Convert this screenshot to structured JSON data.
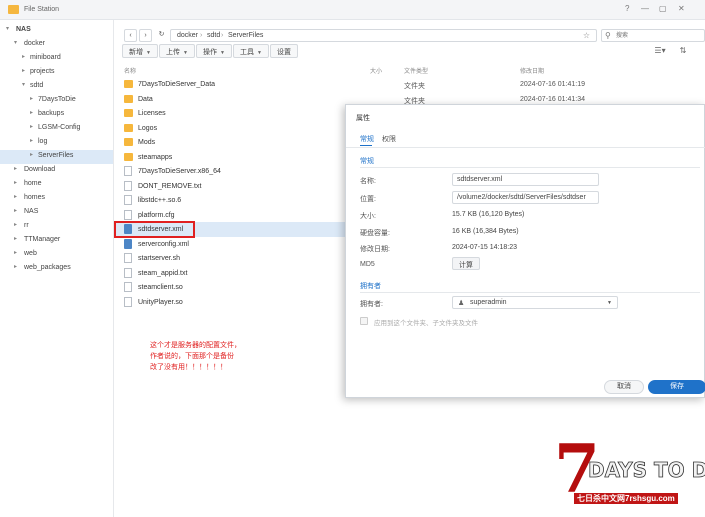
{
  "window": {
    "title": "File Station",
    "controls": [
      "?",
      "—",
      "▢",
      "✕"
    ]
  },
  "sidebar": {
    "items": [
      {
        "label": "NAS",
        "level": 0,
        "expanded": true
      },
      {
        "label": "docker",
        "level": 1,
        "expanded": true
      },
      {
        "label": "miniboard",
        "level": 2,
        "expanded": false
      },
      {
        "label": "projects",
        "level": 2,
        "expanded": false
      },
      {
        "label": "sdtd",
        "level": 2,
        "expanded": true
      },
      {
        "label": "7DaysToDie",
        "level": 3,
        "expanded": false
      },
      {
        "label": "backups",
        "level": 3,
        "expanded": false
      },
      {
        "label": "LGSM-Config",
        "level": 3,
        "expanded": false
      },
      {
        "label": "log",
        "level": 3,
        "expanded": false
      },
      {
        "label": "ServerFiles",
        "level": 3,
        "expanded": false,
        "selected": true
      },
      {
        "label": "Download",
        "level": 1,
        "expanded": false
      },
      {
        "label": "home",
        "level": 1,
        "expanded": false
      },
      {
        "label": "homes",
        "level": 1,
        "expanded": false
      },
      {
        "label": "NAS",
        "level": 1,
        "expanded": false
      },
      {
        "label": "rr",
        "level": 1,
        "expanded": false
      },
      {
        "label": "TTManager",
        "level": 1,
        "expanded": false
      },
      {
        "label": "web",
        "level": 1,
        "expanded": false
      },
      {
        "label": "web_packages",
        "level": 1,
        "expanded": false
      }
    ]
  },
  "pathbar": {
    "crumbs": [
      "docker",
      "sdtd",
      "ServerFiles"
    ],
    "separator": "›"
  },
  "search": {
    "placeholder": "搜索"
  },
  "toolbar": {
    "new_label": "新增",
    "upload_label": "上传",
    "action_label": "操作",
    "tools_label": "工具",
    "settings_label": "设置"
  },
  "list": {
    "headers": {
      "name": "名称",
      "size": "大小",
      "type": "文件类型",
      "date": "修改日期"
    },
    "rows": [
      {
        "name": "7DaysToDieServer_Data",
        "kind": "folder",
        "type": "文件夹",
        "date": "2024-07-16 01:41:19"
      },
      {
        "name": "Data",
        "kind": "folder",
        "type": "文件夹",
        "date": "2024-07-16 01:41:34"
      },
      {
        "name": "Licenses",
        "kind": "folder",
        "type": "",
        "date": ""
      },
      {
        "name": "Logos",
        "kind": "folder",
        "type": "",
        "date": ""
      },
      {
        "name": "Mods",
        "kind": "folder",
        "type": "",
        "date": ""
      },
      {
        "name": "steamapps",
        "kind": "folder",
        "type": "",
        "date": ""
      },
      {
        "name": "7DaysToDieServer.x86_64",
        "kind": "file",
        "type": "",
        "date": ""
      },
      {
        "name": "DONT_REMOVE.txt",
        "kind": "file",
        "type": "",
        "date": ""
      },
      {
        "name": "libstdc++.so.6",
        "kind": "file",
        "type": "",
        "date": ""
      },
      {
        "name": "platform.cfg",
        "kind": "file",
        "type": "",
        "date": ""
      },
      {
        "name": "sdtdserver.xml",
        "kind": "xml",
        "type": "",
        "date": "",
        "selected": true
      },
      {
        "name": "serverconfig.xml",
        "kind": "xml",
        "type": "",
        "date": ""
      },
      {
        "name": "startserver.sh",
        "kind": "file",
        "type": "",
        "date": ""
      },
      {
        "name": "steam_appid.txt",
        "kind": "file",
        "type": "",
        "date": ""
      },
      {
        "name": "steamclient.so",
        "kind": "file",
        "type": "",
        "date": ""
      },
      {
        "name": "UnityPlayer.so",
        "kind": "file",
        "type": "",
        "date": ""
      }
    ]
  },
  "annotation": {
    "lines": [
      "这个才是服务器的配置文件，",
      "作者说的，下面那个是备份",
      "改了没有用！！！！！！"
    ]
  },
  "dialog": {
    "title": "属性",
    "tabs": [
      "常规",
      "权限"
    ],
    "general_section": "常规",
    "name_label": "名称:",
    "name_value": "sdtdserver.xml",
    "location_label": "位置:",
    "location_value": "/volume2/docker/sdtd/ServerFiles/sdtdser",
    "size_label": "大小:",
    "size_value": "15.7 KB (16,120 Bytes)",
    "disk_label": "硬盘容量:",
    "disk_value": "16 KB (16,384 Bytes)",
    "modified_label": "修改日期:",
    "modified_value": "2024-07-15 14:18:23",
    "md5_label": "MD5",
    "calc_label": "计算",
    "owner_section": "拥有者",
    "owner_label": "拥有者:",
    "owner_value": "superadmin",
    "apply_label": "应用到这个文件夹、子文件夹及文件",
    "cancel_label": "取消",
    "save_label": "保存"
  },
  "logo": {
    "big": "7",
    "text": "DAYS TO DIE",
    "sub": "七日杀中文网7rshsgu.com"
  },
  "colors": {
    "accent": "#1f72c9",
    "folder": "#f6b73c",
    "highlight": "#e02020",
    "logo_red": "#b40d0d"
  }
}
